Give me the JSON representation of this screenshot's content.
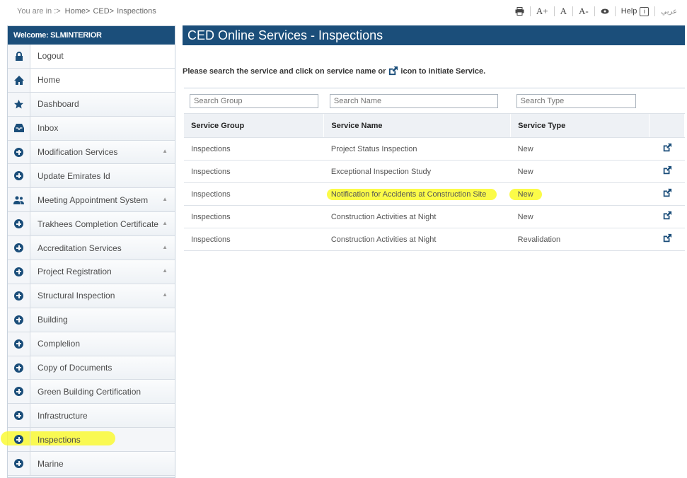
{
  "breadcrumb": {
    "prefix": "You are in :>",
    "items": [
      "Home>",
      "CED>",
      "Inspections"
    ]
  },
  "tools": {
    "font_increase": "A+",
    "font_normal": "A",
    "font_decrease": "A-",
    "help": "Help",
    "help_icon_glyph": "i",
    "language": "عربي"
  },
  "sidebar": {
    "welcome": "Welcome: SLMINTERIOR",
    "items": [
      {
        "label": "Logout",
        "icon": "lock-icon"
      },
      {
        "label": "Home",
        "icon": "home-icon"
      },
      {
        "label": "Dashboard",
        "icon": "star-icon"
      },
      {
        "label": "Inbox",
        "icon": "inbox-icon"
      },
      {
        "label": "Modification Services",
        "icon": "circle-plus-icon",
        "expandable": true
      },
      {
        "label": "Update Emirates Id",
        "icon": "circle-plus-icon"
      },
      {
        "label": "Meeting Appointment System",
        "icon": "people-icon",
        "expandable": true
      },
      {
        "label": "Trakhees Completion Certificate",
        "icon": "circle-plus-icon",
        "expandable": true
      },
      {
        "label": "Accreditation Services",
        "icon": "circle-plus-icon",
        "expandable": true
      },
      {
        "label": "Project Registration",
        "icon": "circle-plus-icon",
        "expandable": true
      },
      {
        "label": "Structural Inspection",
        "icon": "circle-plus-icon",
        "expandable": true
      },
      {
        "label": "Building",
        "icon": "circle-plus-icon"
      },
      {
        "label": "Complelion",
        "icon": "circle-plus-icon"
      },
      {
        "label": "Copy of Documents",
        "icon": "circle-plus-icon"
      },
      {
        "label": "Green Building Certification",
        "icon": "circle-plus-icon"
      },
      {
        "label": "Infrastructure",
        "icon": "circle-plus-icon"
      },
      {
        "label": "Inspections",
        "icon": "circle-plus-icon",
        "highlighted": true
      },
      {
        "label": "Marine",
        "icon": "circle-plus-icon"
      }
    ]
  },
  "main": {
    "title": "CED Online Services - Inspections",
    "instruction_before": "Please search the service and click on service name or",
    "instruction_after": "icon to initiate Service.",
    "search": {
      "group_placeholder": "Search Group",
      "name_placeholder": "Search Name",
      "type_placeholder": "Search Type"
    },
    "columns": [
      "Service Group",
      "Service Name",
      "Service Type"
    ],
    "rows": [
      {
        "group": "Inspections",
        "name": "Project Status Inspection",
        "type": "New"
      },
      {
        "group": "Inspections",
        "name": "Exceptional Inspection Study",
        "type": "New"
      },
      {
        "group": "Inspections",
        "name": "Notification for Accidents at Construction Site",
        "type": "New",
        "highlighted": true
      },
      {
        "group": "Inspections",
        "name": "Construction Activities at Night",
        "type": "New"
      },
      {
        "group": "Inspections",
        "name": "Construction Activities at Night",
        "type": "Revalidation"
      }
    ]
  },
  "colors": {
    "brand_blue": "#1b4e7a",
    "highlight_yellow": "#fafa28"
  }
}
